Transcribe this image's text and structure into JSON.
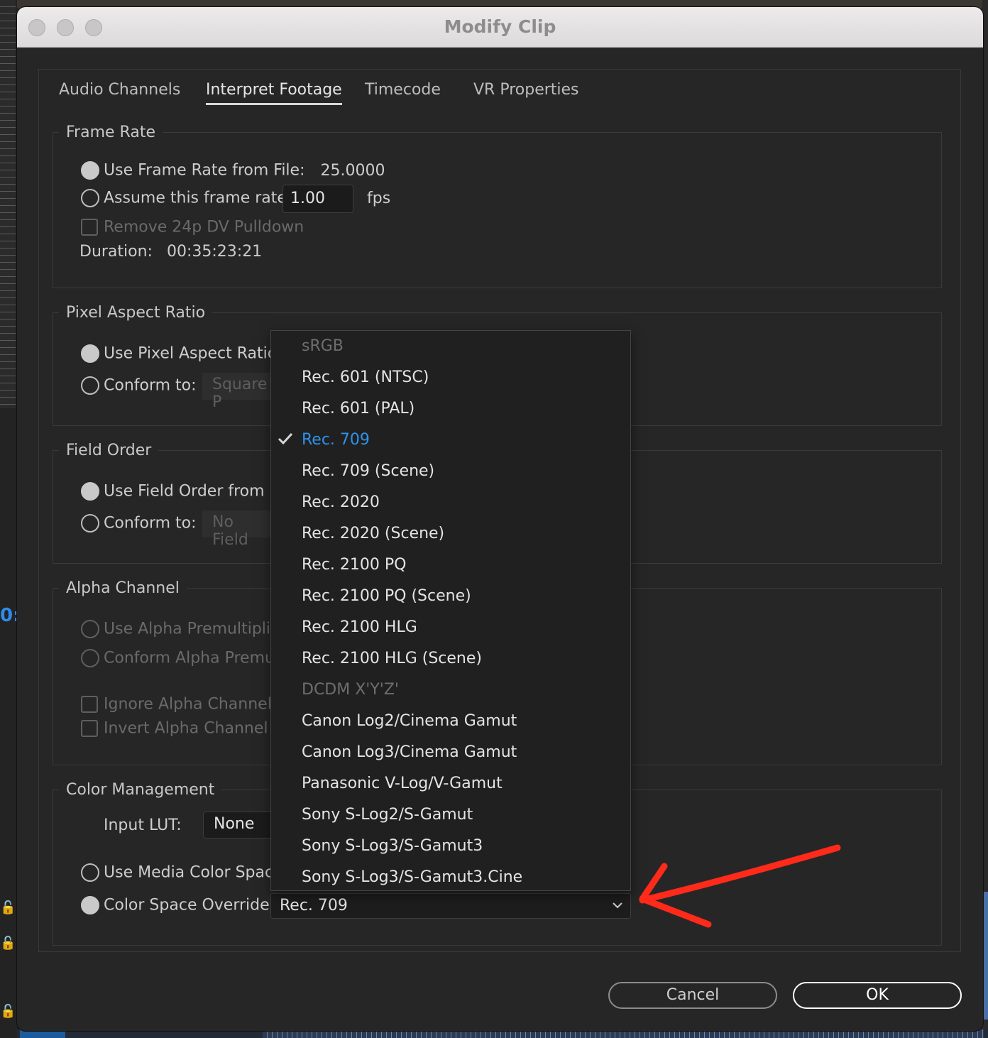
{
  "window": {
    "title": "Modify Clip"
  },
  "background": {
    "timecode_fragment": "0:"
  },
  "tabs": [
    "Audio Channels",
    "Interpret Footage",
    "Timecode",
    "VR Properties"
  ],
  "frame_rate": {
    "legend": "Frame Rate",
    "from_file_label": "Use Frame Rate from File:",
    "from_file_value": "25.0000",
    "assume_label": "Assume this frame rate:",
    "assume_value": "1.00",
    "fps_unit": "fps",
    "pulldown_label": "Remove 24p DV Pulldown",
    "duration_label": "Duration:",
    "duration_value": "00:35:23:21"
  },
  "pixel_aspect": {
    "legend": "Pixel Aspect Ratio",
    "from_file_label": "Use Pixel Aspect Ratio fr",
    "conform_label": "Conform to:",
    "conform_value": "Square P"
  },
  "field_order": {
    "legend": "Field Order",
    "from_file_label": "Use Field Order from Fil",
    "conform_label": "Conform to:",
    "conform_value": "No Field"
  },
  "alpha": {
    "legend": "Alpha Channel",
    "premult_label": "Use Alpha Premultiplica",
    "conform_premult_label": "Conform Alpha Premult",
    "ignore_label": "Ignore Alpha Channel",
    "invert_label": "Invert Alpha Channel"
  },
  "color_mgmt": {
    "legend": "Color Management",
    "lut_label": "Input LUT:",
    "lut_value": "None",
    "media_space_label": "Use Media Color Space f",
    "override_label": "Color Space Override:",
    "override_value": "Rec. 709"
  },
  "color_space_menu": {
    "items": [
      {
        "label": "sRGB",
        "state": "disabled"
      },
      {
        "label": "Rec. 601 (NTSC)",
        "state": "enabled"
      },
      {
        "label": "Rec. 601 (PAL)",
        "state": "enabled"
      },
      {
        "label": "Rec. 709",
        "state": "selected"
      },
      {
        "label": "Rec. 709 (Scene)",
        "state": "enabled"
      },
      {
        "label": "Rec. 2020",
        "state": "enabled"
      },
      {
        "label": "Rec. 2020 (Scene)",
        "state": "enabled"
      },
      {
        "label": "Rec. 2100 PQ",
        "state": "enabled"
      },
      {
        "label": "Rec. 2100 PQ (Scene)",
        "state": "enabled"
      },
      {
        "label": "Rec. 2100 HLG",
        "state": "enabled"
      },
      {
        "label": "Rec. 2100 HLG (Scene)",
        "state": "enabled"
      },
      {
        "label": "DCDM X'Y'Z'",
        "state": "disabled"
      },
      {
        "label": "Canon Log2/Cinema Gamut",
        "state": "enabled"
      },
      {
        "label": "Canon Log3/Cinema Gamut",
        "state": "enabled"
      },
      {
        "label": "Panasonic V-Log/V-Gamut",
        "state": "enabled"
      },
      {
        "label": "Sony S-Log2/S-Gamut",
        "state": "enabled"
      },
      {
        "label": "Sony S-Log3/S-Gamut3",
        "state": "enabled"
      },
      {
        "label": "Sony S-Log3/S-Gamut3.Cine",
        "state": "enabled"
      }
    ],
    "selected_color": "#2f92ea"
  },
  "buttons": {
    "cancel": "Cancel",
    "ok": "OK"
  },
  "annotation": {
    "arrow_color": "#ff2a1a"
  }
}
